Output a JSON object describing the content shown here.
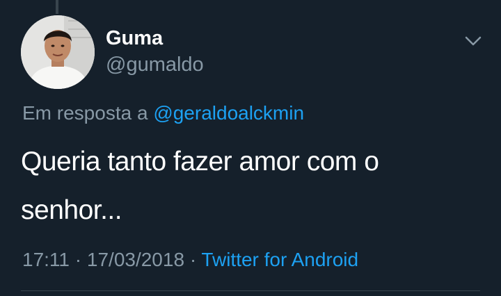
{
  "user": {
    "display_name": "Guma",
    "handle": "@gumaldo"
  },
  "reply": {
    "prefix": "Em resposta a",
    "mention": "@geraldoalckmin"
  },
  "tweet": {
    "text": "Queria tanto fazer amor com o senhor..."
  },
  "meta": {
    "time": "17:11",
    "separator1": "·",
    "date": "17/03/2018",
    "separator2": "·",
    "source": "Twitter for Android"
  },
  "icons": {
    "menu": "chevron-down-icon"
  },
  "colors": {
    "background": "#15202b",
    "text_primary": "#ffffff",
    "text_secondary": "#8899a6",
    "accent": "#1da1f2"
  }
}
